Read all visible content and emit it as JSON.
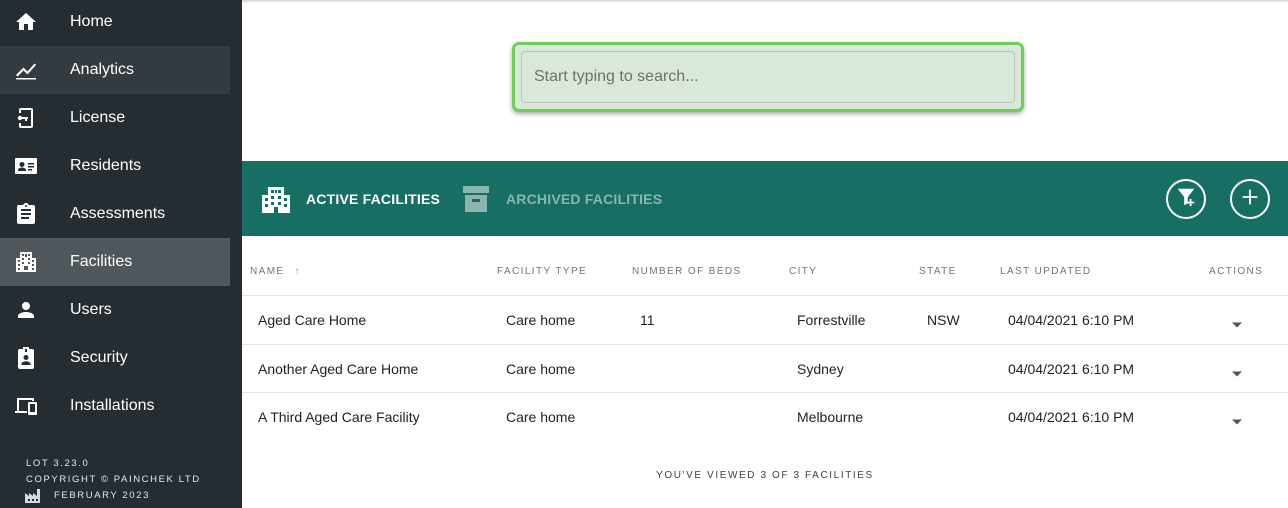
{
  "sidebar": {
    "items": [
      {
        "label": "Home",
        "icon": "home-icon"
      },
      {
        "label": "Analytics",
        "icon": "analytics-icon"
      },
      {
        "label": "License",
        "icon": "license-icon"
      },
      {
        "label": "Residents",
        "icon": "residents-icon"
      },
      {
        "label": "Assessments",
        "icon": "assessments-icon"
      },
      {
        "label": "Facilities",
        "icon": "facilities-icon"
      },
      {
        "label": "Users",
        "icon": "users-icon"
      },
      {
        "label": "Security",
        "icon": "security-icon"
      },
      {
        "label": "Installations",
        "icon": "installations-icon"
      }
    ],
    "footer": {
      "version": "LOT 3.23.0",
      "copyright": "COPYRIGHT © PAINCHEK LTD",
      "date": "FEBRUARY 2023"
    }
  },
  "search": {
    "placeholder": "Start typing to search..."
  },
  "tabs": {
    "active_label": "ACTIVE FACILITIES",
    "archived_label": "ARCHIVED FACILITIES"
  },
  "table": {
    "headers": {
      "name": "NAME",
      "sort_indicator": "↑",
      "facility_type": "FACILITY TYPE",
      "beds": "NUMBER OF BEDS",
      "city": "CITY",
      "state": "STATE",
      "last_updated": "LAST UPDATED",
      "actions": "ACTIONS"
    },
    "rows": [
      {
        "name": "Aged Care Home",
        "type": "Care home",
        "beds": "11",
        "city": "Forrestville",
        "state": "NSW",
        "updated": "04/04/2021 6:10 PM"
      },
      {
        "name": "Another Aged Care Home",
        "type": "Care home",
        "beds": "",
        "city": "Sydney",
        "state": "",
        "updated": "04/04/2021 6:10 PM"
      },
      {
        "name": "A Third Aged Care Facility",
        "type": "Care home",
        "beds": "",
        "city": "Melbourne",
        "state": "",
        "updated": "04/04/2021 6:10 PM"
      }
    ],
    "viewed_text": "YOU'VE VIEWED 3 OF 3 FACILITIES"
  },
  "colors": {
    "sidebar_bg": "#252d32",
    "sidebar_active": "#4f575c",
    "tabbar_bg": "#176f64",
    "search_highlight": "#6fcf5a"
  }
}
